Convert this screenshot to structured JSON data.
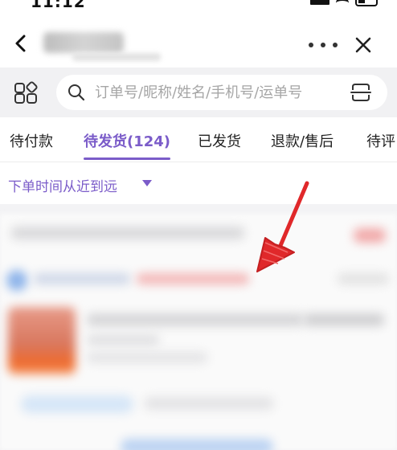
{
  "status_bar": {
    "time": "11:12"
  },
  "search": {
    "placeholder": "订单号/昵称/姓名/手机号/运单号"
  },
  "tabs": [
    {
      "label": "待付款"
    },
    {
      "label": "待发货(124)",
      "active": true
    },
    {
      "label": "已发货"
    },
    {
      "label": "退款/售后"
    },
    {
      "label": "待评"
    }
  ],
  "sort": {
    "label": "下单时间从近到远"
  },
  "colors": {
    "accent": "#7b5cc9",
    "search_bg": "#f1f1f3",
    "annotation_arrow": "#e0282a"
  },
  "icons": {
    "back": "chevron-left-icon",
    "more": "more-dots-icon",
    "close": "close-icon",
    "grid": "grid-icon",
    "search": "search-icon",
    "scan": "scan-icon",
    "sort": "caret-down-icon"
  }
}
